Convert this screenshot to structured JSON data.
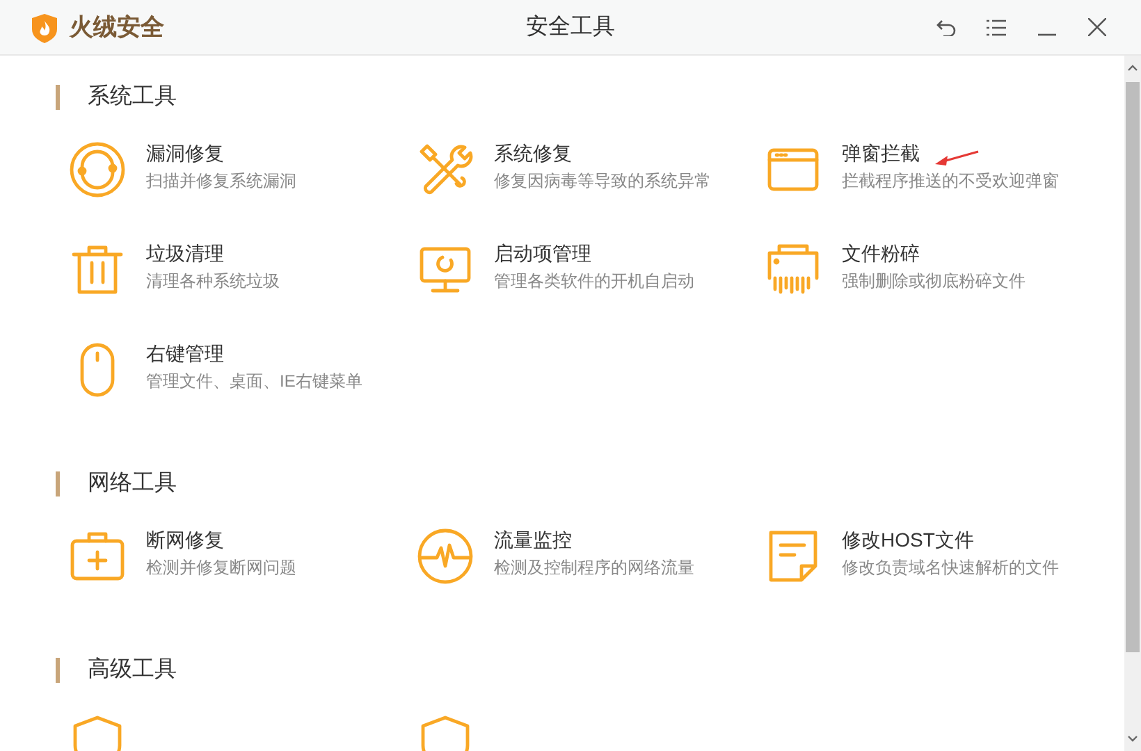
{
  "app": {
    "name": "火绒安全"
  },
  "window": {
    "title": "安全工具"
  },
  "sections": [
    {
      "title": "系统工具",
      "items": [
        {
          "kind": "bug",
          "title": "漏洞修复",
          "desc": "扫描并修复系统漏洞"
        },
        {
          "kind": "tools",
          "title": "系统修复",
          "desc": "修复因病毒等导致的系统异常"
        },
        {
          "kind": "popup",
          "title": "弹窗拦截",
          "desc": "拦截程序推送的不受欢迎弹窗"
        },
        {
          "kind": "trash",
          "title": "垃圾清理",
          "desc": "清理各种系统垃圾"
        },
        {
          "kind": "monitor",
          "title": "启动项管理",
          "desc": "管理各类软件的开机自启动"
        },
        {
          "kind": "shredder",
          "title": "文件粉碎",
          "desc": "强制删除或彻底粉碎文件"
        },
        {
          "kind": "mouse",
          "title": "右键管理",
          "desc": "管理文件、桌面、IE右键菜单"
        }
      ]
    },
    {
      "title": "网络工具",
      "items": [
        {
          "kind": "kit",
          "title": "断网修复",
          "desc": "检测并修复断网问题"
        },
        {
          "kind": "pulse",
          "title": "流量监控",
          "desc": "检测及控制程序的网络流量"
        },
        {
          "kind": "note",
          "title": "修改HOST文件",
          "desc": "修改负责域名快速解析的文件"
        }
      ]
    },
    {
      "title": "高级工具",
      "items": [
        {
          "kind": "shield"
        },
        {
          "kind": "shield"
        }
      ]
    }
  ]
}
